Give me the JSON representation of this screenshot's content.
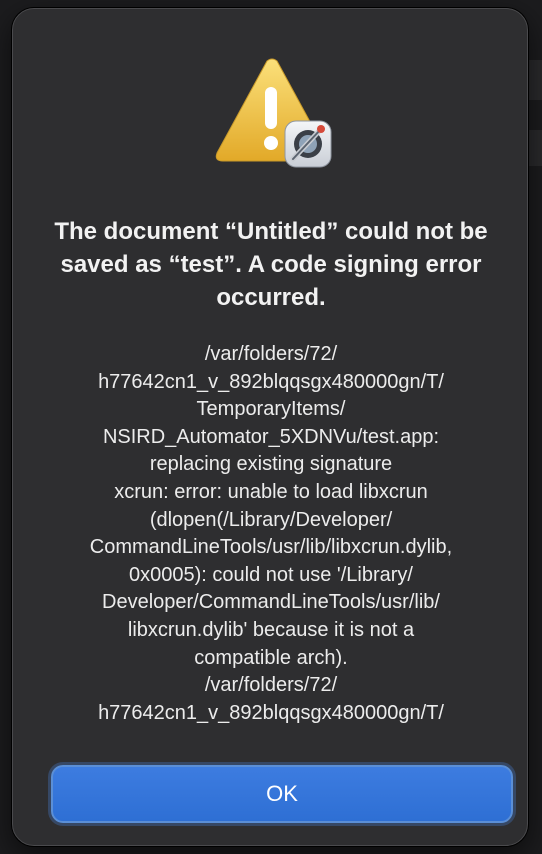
{
  "alert": {
    "icon": "warning-triangle-with-automator-app-icon",
    "title": "The document “Untitled” could not be saved as “test”. A code signing error occurred.",
    "message": "/var/folders/72/\nh77642cn1_v_892blqqsgx480000gn/T/\nTemporaryItems/\nNSIRD_Automator_5XDNVu/test.app:\nreplacing existing signature\nxcrun: error: unable to load libxcrun\n(dlopen(/Library/Developer/\nCommandLineTools/usr/lib/libxcrun.dylib,\n0x0005): could not use '/Library/\nDeveloper/CommandLineTools/usr/lib/\nlibxcrun.dylib' because it is not a\ncompatible arch).\n/var/folders/72/\nh77642cn1_v_892blqqsgx480000gn/T/",
    "ok_label": "OK"
  },
  "colors": {
    "dialog_background": "#2e2e30",
    "button_accent": "#3478e0",
    "warning_yellow": "#f5c542"
  }
}
